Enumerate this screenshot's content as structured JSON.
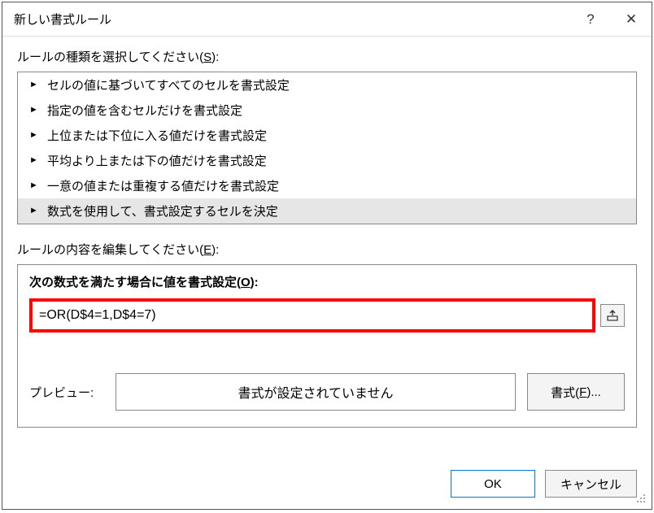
{
  "titlebar": {
    "title": "新しい書式ルール",
    "help": "?",
    "close": "✕"
  },
  "section1": {
    "label_pre": "ルールの種類を選択してください(",
    "label_hot": "S",
    "label_post": "):"
  },
  "rules": [
    {
      "text": "セルの値に基づいてすべてのセルを書式設定",
      "selected": false
    },
    {
      "text": "指定の値を含むセルだけを書式設定",
      "selected": false
    },
    {
      "text": "上位または下位に入る値だけを書式設定",
      "selected": false
    },
    {
      "text": "平均より上または下の値だけを書式設定",
      "selected": false
    },
    {
      "text": "一意の値または重複する値だけを書式設定",
      "selected": false
    },
    {
      "text": "数式を使用して、書式設定するセルを決定",
      "selected": true
    }
  ],
  "section2": {
    "label_pre": "ルールの内容を編集してください(",
    "label_hot": "E",
    "label_post": "):"
  },
  "edit": {
    "heading_pre": "次の数式を満たす場合に値を書式設定(",
    "heading_hot": "O",
    "heading_post": "):",
    "formula": "=OR(D$4=1,D$4=7)"
  },
  "preview": {
    "label": "プレビュー:",
    "text": "書式が設定されていません",
    "button_pre": "書式(",
    "button_hot": "F",
    "button_post": ")..."
  },
  "buttons": {
    "ok": "OK",
    "cancel": "キャンセル"
  }
}
